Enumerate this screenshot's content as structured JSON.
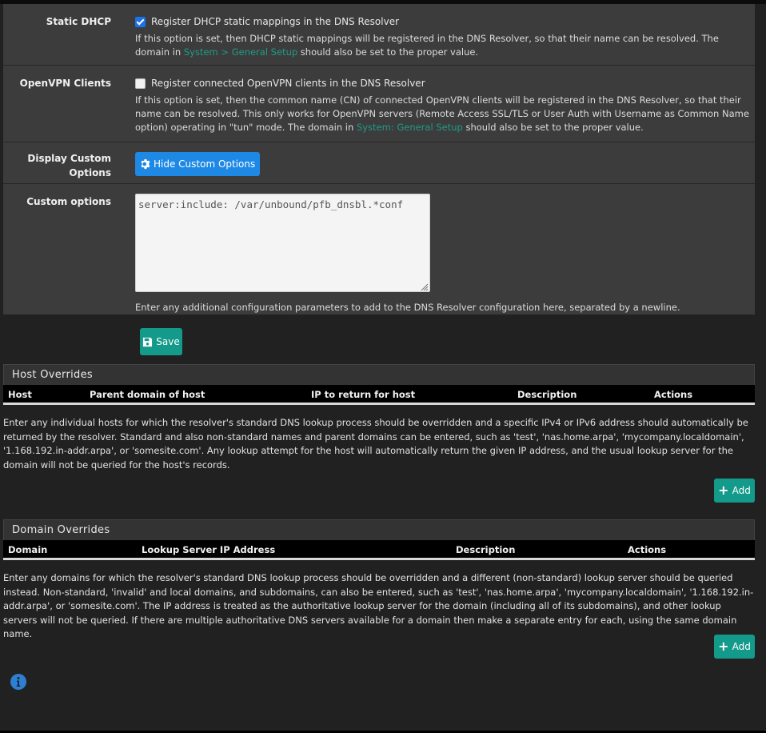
{
  "settings": {
    "static_dhcp": {
      "label": "Static DHCP",
      "checkbox_label": "Register DHCP static mappings in the DNS Resolver",
      "checked": true,
      "help_pre": "If this option is set, then DHCP static mappings will be registered in the DNS Resolver, so that their name can be resolved. The domain in ",
      "help_link": "System > General Setup",
      "help_post": " should also be set to the proper value."
    },
    "openvpn_clients": {
      "label": "OpenVPN Clients",
      "checkbox_label": "Register connected OpenVPN clients in the DNS Resolver",
      "checked": false,
      "help_pre": "If this option is set, then the common name (CN) of connected OpenVPN clients will be registered in the DNS Resolver, so that their name can be resolved. This only works for OpenVPN servers (Remote Access SSL/TLS or User Auth with Username as Common Name option) operating in \"tun\" mode. The domain in ",
      "help_link": "System: General Setup",
      "help_post": " should also be set to the proper value."
    },
    "display_custom_options": {
      "label": "Display Custom Options",
      "button_label": "Hide Custom Options",
      "button_icon": "gear-icon"
    },
    "custom_options": {
      "label": "Custom options",
      "value": "server:include: /var/unbound/pfb_dnsbl.*conf",
      "help": "Enter any additional configuration parameters to add to the DNS Resolver configuration here, separated by a newline."
    }
  },
  "save_button": {
    "label": "Save",
    "icon": "floppy-disk-icon"
  },
  "host_overrides": {
    "title": "Host Overrides",
    "columns": [
      "Host",
      "Parent domain of host",
      "IP to return for host",
      "Description",
      "Actions"
    ],
    "rows": [],
    "help": "Enter any individual hosts for which the resolver's standard DNS lookup process should be overridden and a specific IPv4 or IPv6 address should automatically be returned by the resolver. Standard and also non-standard names and parent domains can be entered, such as 'test', 'nas.home.arpa', 'mycompany.localdomain', '1.168.192.in-addr.arpa', or 'somesite.com'. Any lookup attempt for the host will automatically return the given IP address, and the usual lookup server for the domain will not be queried for the host's records.",
    "add_label": "Add"
  },
  "domain_overrides": {
    "title": "Domain Overrides",
    "columns": [
      "Domain",
      "Lookup Server IP Address",
      "Description",
      "Actions"
    ],
    "rows": [],
    "help": "Enter any domains for which the resolver's standard DNS lookup process should be overridden and a different (non-standard) lookup server should be queried instead. Non-standard, 'invalid' and local domains, and subdomains, can also be entered, such as 'test', 'nas.home.arpa', 'mycompany.localdomain', '1.168.192.in-addr.arpa', or 'somesite.com'. The IP address is treated as the authoritative lookup server for the domain (including all of its subdomains), and other lookup servers will not be queried. If there are multiple authoritative DNS servers available for a domain then make a separate entry for each, using the same domain name.",
    "add_label": "Add"
  },
  "colors": {
    "primary_blue": "#1e88e5",
    "teal_success": "#139a8a",
    "link": "#1f9c88",
    "panel_bg": "#3c3c3c",
    "page_bg": "#212121"
  }
}
